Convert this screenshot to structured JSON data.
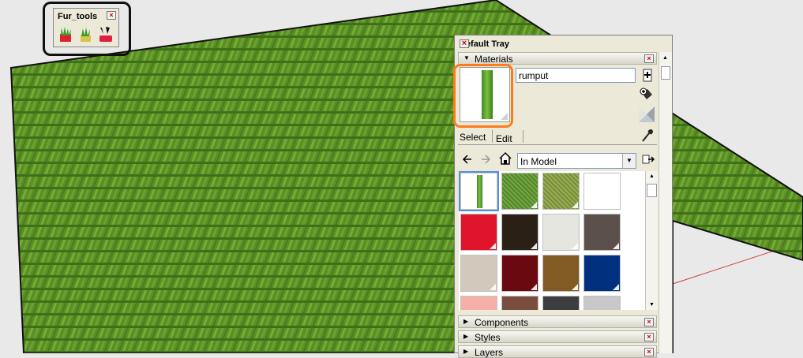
{
  "toolbar": {
    "title": "Fur_tools",
    "close": "×"
  },
  "tray": {
    "title": "Default Tray",
    "close": "×",
    "materials": {
      "header": "Materials",
      "close": "×",
      "name_value": "rumput",
      "tab_select": "Select",
      "tab_edit": "Edit",
      "collection": "In Model",
      "swatches": [
        {
          "color": "#ffffff",
          "kind": "grass-strip"
        },
        {
          "color": "#5f9a2e",
          "kind": "grass"
        },
        {
          "color": "#86a33f",
          "kind": "grass-light"
        },
        {
          "color": "#ffffff",
          "kind": "plain"
        },
        {
          "color": "#e0142a",
          "kind": "plain"
        },
        {
          "color": "#2b2016",
          "kind": "plain"
        },
        {
          "color": "#e6e6e0",
          "kind": "plain"
        },
        {
          "color": "#5c504c",
          "kind": "plain"
        },
        {
          "color": "#d2c8bc",
          "kind": "plain"
        },
        {
          "color": "#6a0a10",
          "kind": "plain"
        },
        {
          "color": "#825a24",
          "kind": "plain"
        },
        {
          "color": "#00307e",
          "kind": "plain"
        },
        {
          "color": "#f4b0a6",
          "kind": "plain"
        },
        {
          "color": "#7a4e3c",
          "kind": "plain"
        },
        {
          "color": "#3c3e40",
          "kind": "plain"
        },
        {
          "color": "#c8c8c8",
          "kind": "plain"
        }
      ]
    },
    "panels": [
      {
        "label": "Components",
        "close": "×"
      },
      {
        "label": "Styles",
        "close": "×"
      },
      {
        "label": "Layers",
        "close": "×"
      }
    ]
  },
  "colors": {
    "grass": "#5a8f25",
    "highlight": "#ff7a1a",
    "selection": "#5b8fd6"
  }
}
